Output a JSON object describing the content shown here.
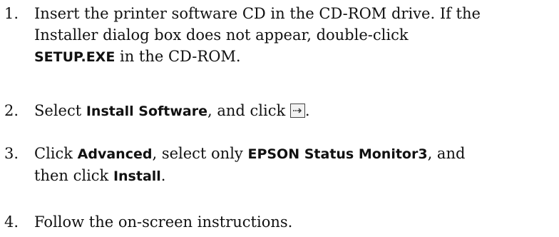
{
  "steps": [
    {
      "number": "1.",
      "line1": "Insert the printer software CD in the CD-ROM drive. If the",
      "line2": "Installer dialog box does not appear, double-click",
      "line3_bold": "SETUP.EXE",
      "line3_rest": " in the CD-ROM."
    },
    {
      "number": "2.",
      "pre": "Select ",
      "bold": "Install Software",
      "mid": ", and click ",
      "button_icon": "arrow-right-icon",
      "post": "."
    },
    {
      "number": "3.",
      "pre": "Click ",
      "bold1": "Advanced",
      "mid": ", select only ",
      "bold2": "EPSON Status Monitor3",
      "post": ", and",
      "line2_pre": "then click ",
      "line2_bold": "Install",
      "line2_post": "."
    },
    {
      "number": "4.",
      "text": "Follow the on-screen instructions."
    }
  ]
}
